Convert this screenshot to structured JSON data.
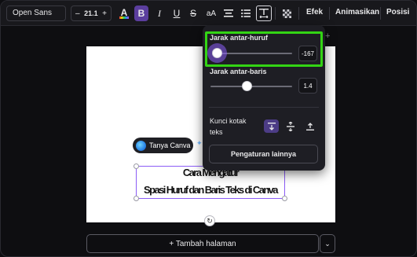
{
  "toolbar": {
    "font": "Open Sans",
    "size_minus": "–",
    "size_value": "21.1",
    "size_plus": "+",
    "text_color_icon": "A",
    "bold_icon": "B",
    "italic_icon": "I",
    "underline_icon": "U",
    "strike_icon": "S",
    "case_icon": "aA",
    "effects_label": "Efek",
    "animate_label": "Animasikan",
    "position_label": "Posisi"
  },
  "spacing_panel": {
    "letter_spacing_label": "Jarak antar-huruf",
    "letter_spacing_value": "-167",
    "letter_spacing_fraction": 0.0,
    "line_spacing_label": "Jarak antar-baris",
    "line_spacing_value": "1.4",
    "lock_label": "Kunci kotak teks",
    "more_settings_label": "Pengaturan lainnya"
  },
  "canvas": {
    "ask_canva_label": "Tanya Canva",
    "text_line_1": "Cara Mengatur",
    "text_line_2": "Spasi Huruf dan Baris Teks di Canva"
  },
  "footer": {
    "add_page_label": "+ Tambah halaman"
  },
  "colors": {
    "accent": "#8b5cf6",
    "highlight": "#33d414",
    "bold_active": "#5b3e9e"
  }
}
